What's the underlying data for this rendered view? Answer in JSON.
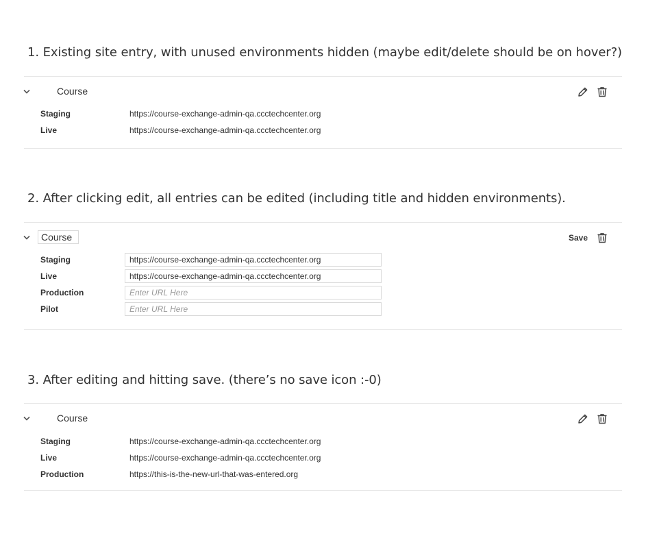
{
  "sections": [
    {
      "heading": "1. Existing site entry, with unused environments hidden (maybe edit/delete should be on hover?)",
      "title": "Course",
      "environments": [
        {
          "label": "Staging",
          "value": "https://course-exchange-admin-qa.ccctechcenter.org"
        },
        {
          "label": "Live",
          "value": "https://course-exchange-admin-qa.ccctechcenter.org"
        }
      ]
    },
    {
      "heading": "2. After clicking edit, all entries can be edited (including title and hidden environments).",
      "title": "Course",
      "save_label": "Save",
      "environments": [
        {
          "label": "Staging",
          "value": "https://course-exchange-admin-qa.ccctechcenter.org",
          "placeholder": ""
        },
        {
          "label": "Live",
          "value": "https://course-exchange-admin-qa.ccctechcenter.org",
          "placeholder": ""
        },
        {
          "label": "Production",
          "value": "",
          "placeholder": "Enter URL Here"
        },
        {
          "label": "Pilot",
          "value": "",
          "placeholder": "Enter URL Here"
        }
      ]
    },
    {
      "heading": "3. After editing and hitting save. (there’s no save icon :-0)",
      "title": "Course",
      "environments": [
        {
          "label": "Staging",
          "value": "https://course-exchange-admin-qa.ccctechcenter.org"
        },
        {
          "label": "Live",
          "value": "https://course-exchange-admin-qa.ccctechcenter.org"
        },
        {
          "label": "Production",
          "value": "https://this-is-the-new-url-that-was-entered.org"
        }
      ]
    }
  ],
  "icons": {
    "collapse": "chevron-down-icon",
    "edit": "pencil-icon",
    "delete": "trash-icon"
  },
  "colors": {
    "text": "#333333",
    "divider": "#e6e6e6",
    "input_border": "#d9d9d9",
    "placeholder": "#999999"
  }
}
